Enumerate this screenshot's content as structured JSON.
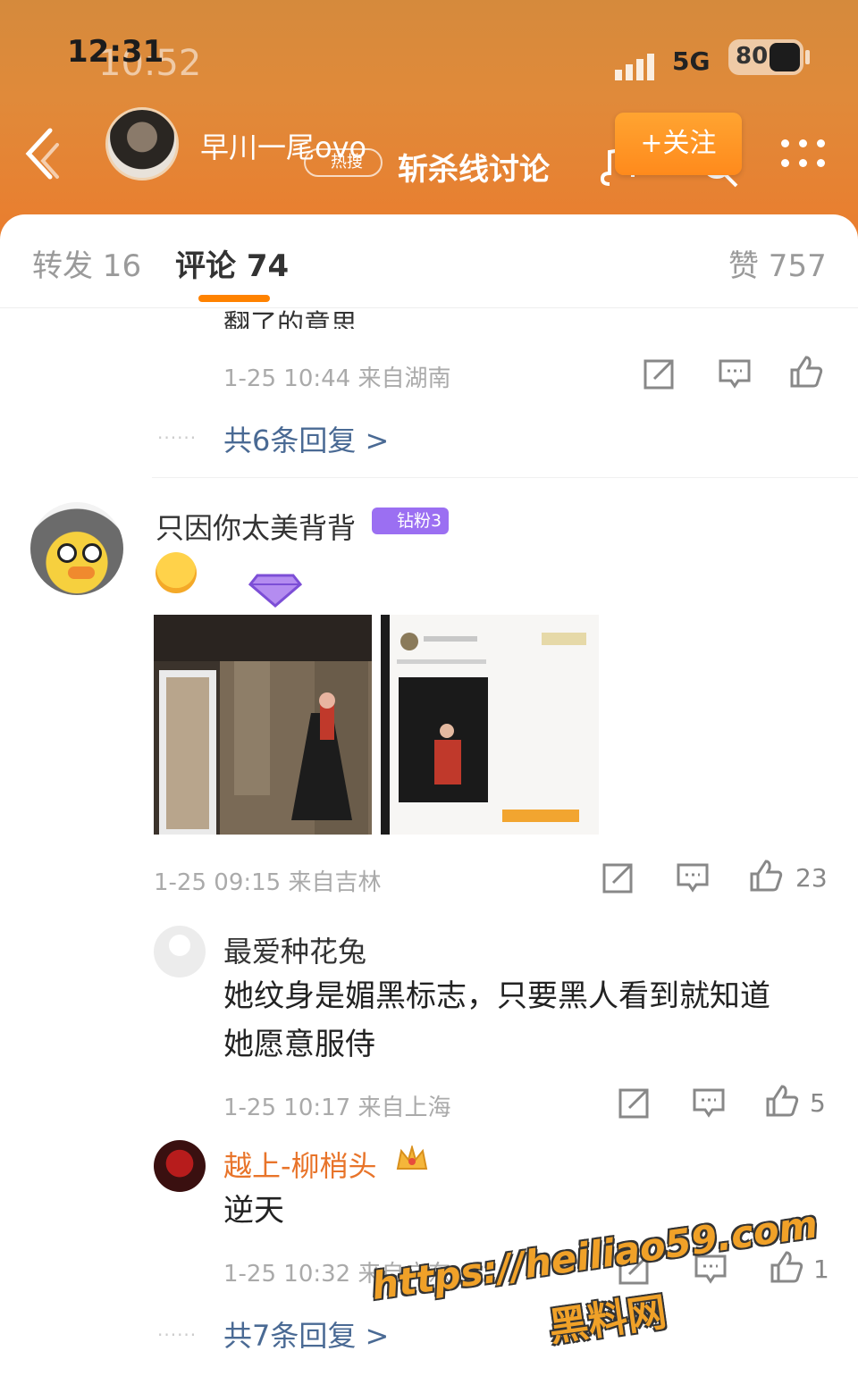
{
  "status_bar": {
    "time_front": "12:31",
    "time_back": "10:52",
    "network": "5G",
    "battery": "80"
  },
  "nav": {
    "username": "早川一尾ovo",
    "hot_badge": "热搜",
    "topic": "斩杀线讨论",
    "follow_label": "+关注"
  },
  "tabs": {
    "repost": "转发 16",
    "comments": "评论 74",
    "likes": "赞 757"
  },
  "comments": [
    {
      "cut_text": "翻了的意思",
      "meta": "1-25 10:44 来自湖南",
      "more_replies": "共6条回复 >"
    },
    {
      "author": "只因你太美背背",
      "badge": "钻粉3",
      "meta": "1-25 09:15 来自吉林",
      "like_count": "23",
      "replies": [
        {
          "author": "最爱种花兔",
          "text_line1": "她纹身是媚黑标志，只要黑人看到就知道",
          "text_line2": "她愿意服侍",
          "meta": "1-25 10:17 来自上海",
          "like_count": "5"
        },
        {
          "author": "越上-柳梢头",
          "text_line1": "逆天",
          "meta": "1-25 10:32 来自广东",
          "like_count": "1"
        }
      ],
      "more_replies": "共7条回复 >"
    }
  ],
  "watermark": {
    "url": "https://heiliao59.com",
    "name": "黑料网"
  },
  "colors": {
    "accent": "#ff8200",
    "link": "#4a6a94",
    "header": "#e08a3a",
    "vip": "#9b6ff2"
  }
}
